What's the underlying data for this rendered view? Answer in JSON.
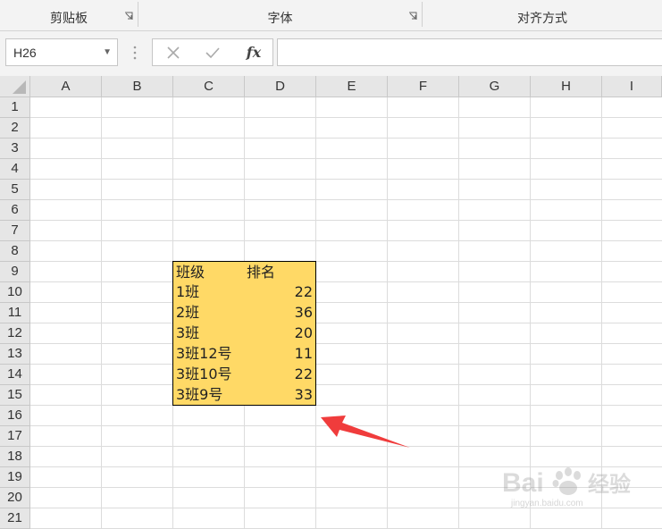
{
  "ribbon": {
    "groups": [
      {
        "label": "剪贴板"
      },
      {
        "label": "字体"
      },
      {
        "label": "对齐方式"
      }
    ]
  },
  "formula_bar": {
    "name_box": "H26",
    "cancel_icon": "close-icon",
    "enter_icon": "check-icon",
    "fx_label": "fx",
    "formula_value": ""
  },
  "sheet": {
    "columns": [
      "A",
      "B",
      "C",
      "D",
      "E",
      "F",
      "G",
      "H",
      "I"
    ],
    "rows": [
      "1",
      "2",
      "3",
      "4",
      "5",
      "6",
      "7",
      "8",
      "9",
      "10",
      "11",
      "12",
      "13",
      "14",
      "15",
      "16",
      "17",
      "18",
      "19",
      "20",
      "21"
    ],
    "table": {
      "header": [
        "班级",
        "排名"
      ],
      "rows": [
        [
          "1班",
          "22"
        ],
        [
          "2班",
          "36"
        ],
        [
          "3班",
          "20"
        ],
        [
          "3班12号",
          "11"
        ],
        [
          "3班10号",
          "22"
        ],
        [
          "3班9号",
          "33"
        ]
      ],
      "fill_color": "#ffd966"
    }
  },
  "annotation": {
    "arrow_color": "#f03c3c"
  },
  "watermark": {
    "text": "Baidu 经验",
    "url_text": "jingyan.baidu.com"
  }
}
